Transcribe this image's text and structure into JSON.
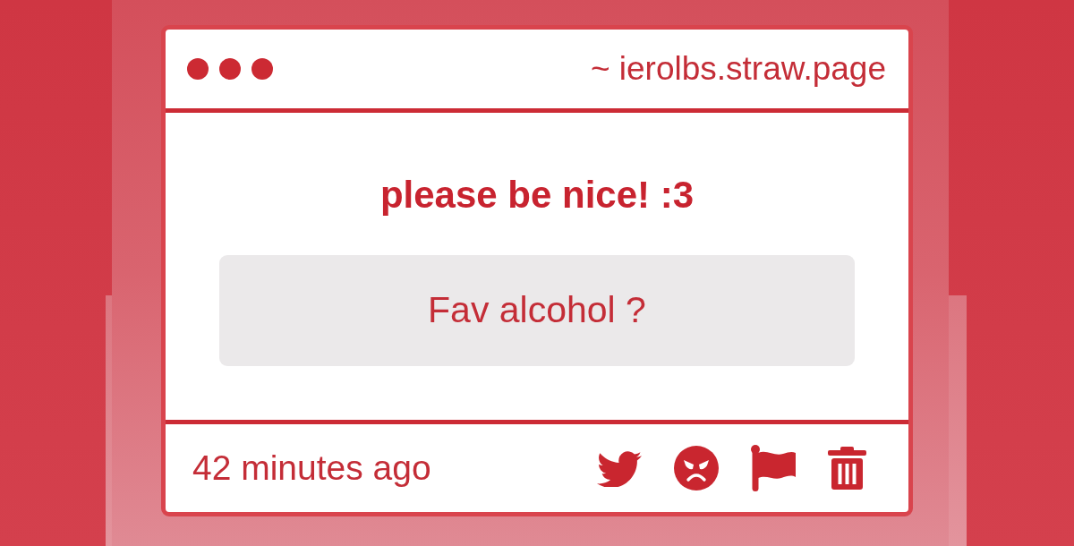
{
  "window": {
    "address": "~ ierolbs.straw.page"
  },
  "prompt": {
    "title": "please be nice! :3"
  },
  "question": {
    "text": "Fav alcohol ?"
  },
  "footer": {
    "time": "42 minutes ago",
    "actions": [
      {
        "kind": "tweet"
      },
      {
        "kind": "angry"
      },
      {
        "kind": "flag"
      },
      {
        "kind": "delete"
      }
    ]
  }
}
